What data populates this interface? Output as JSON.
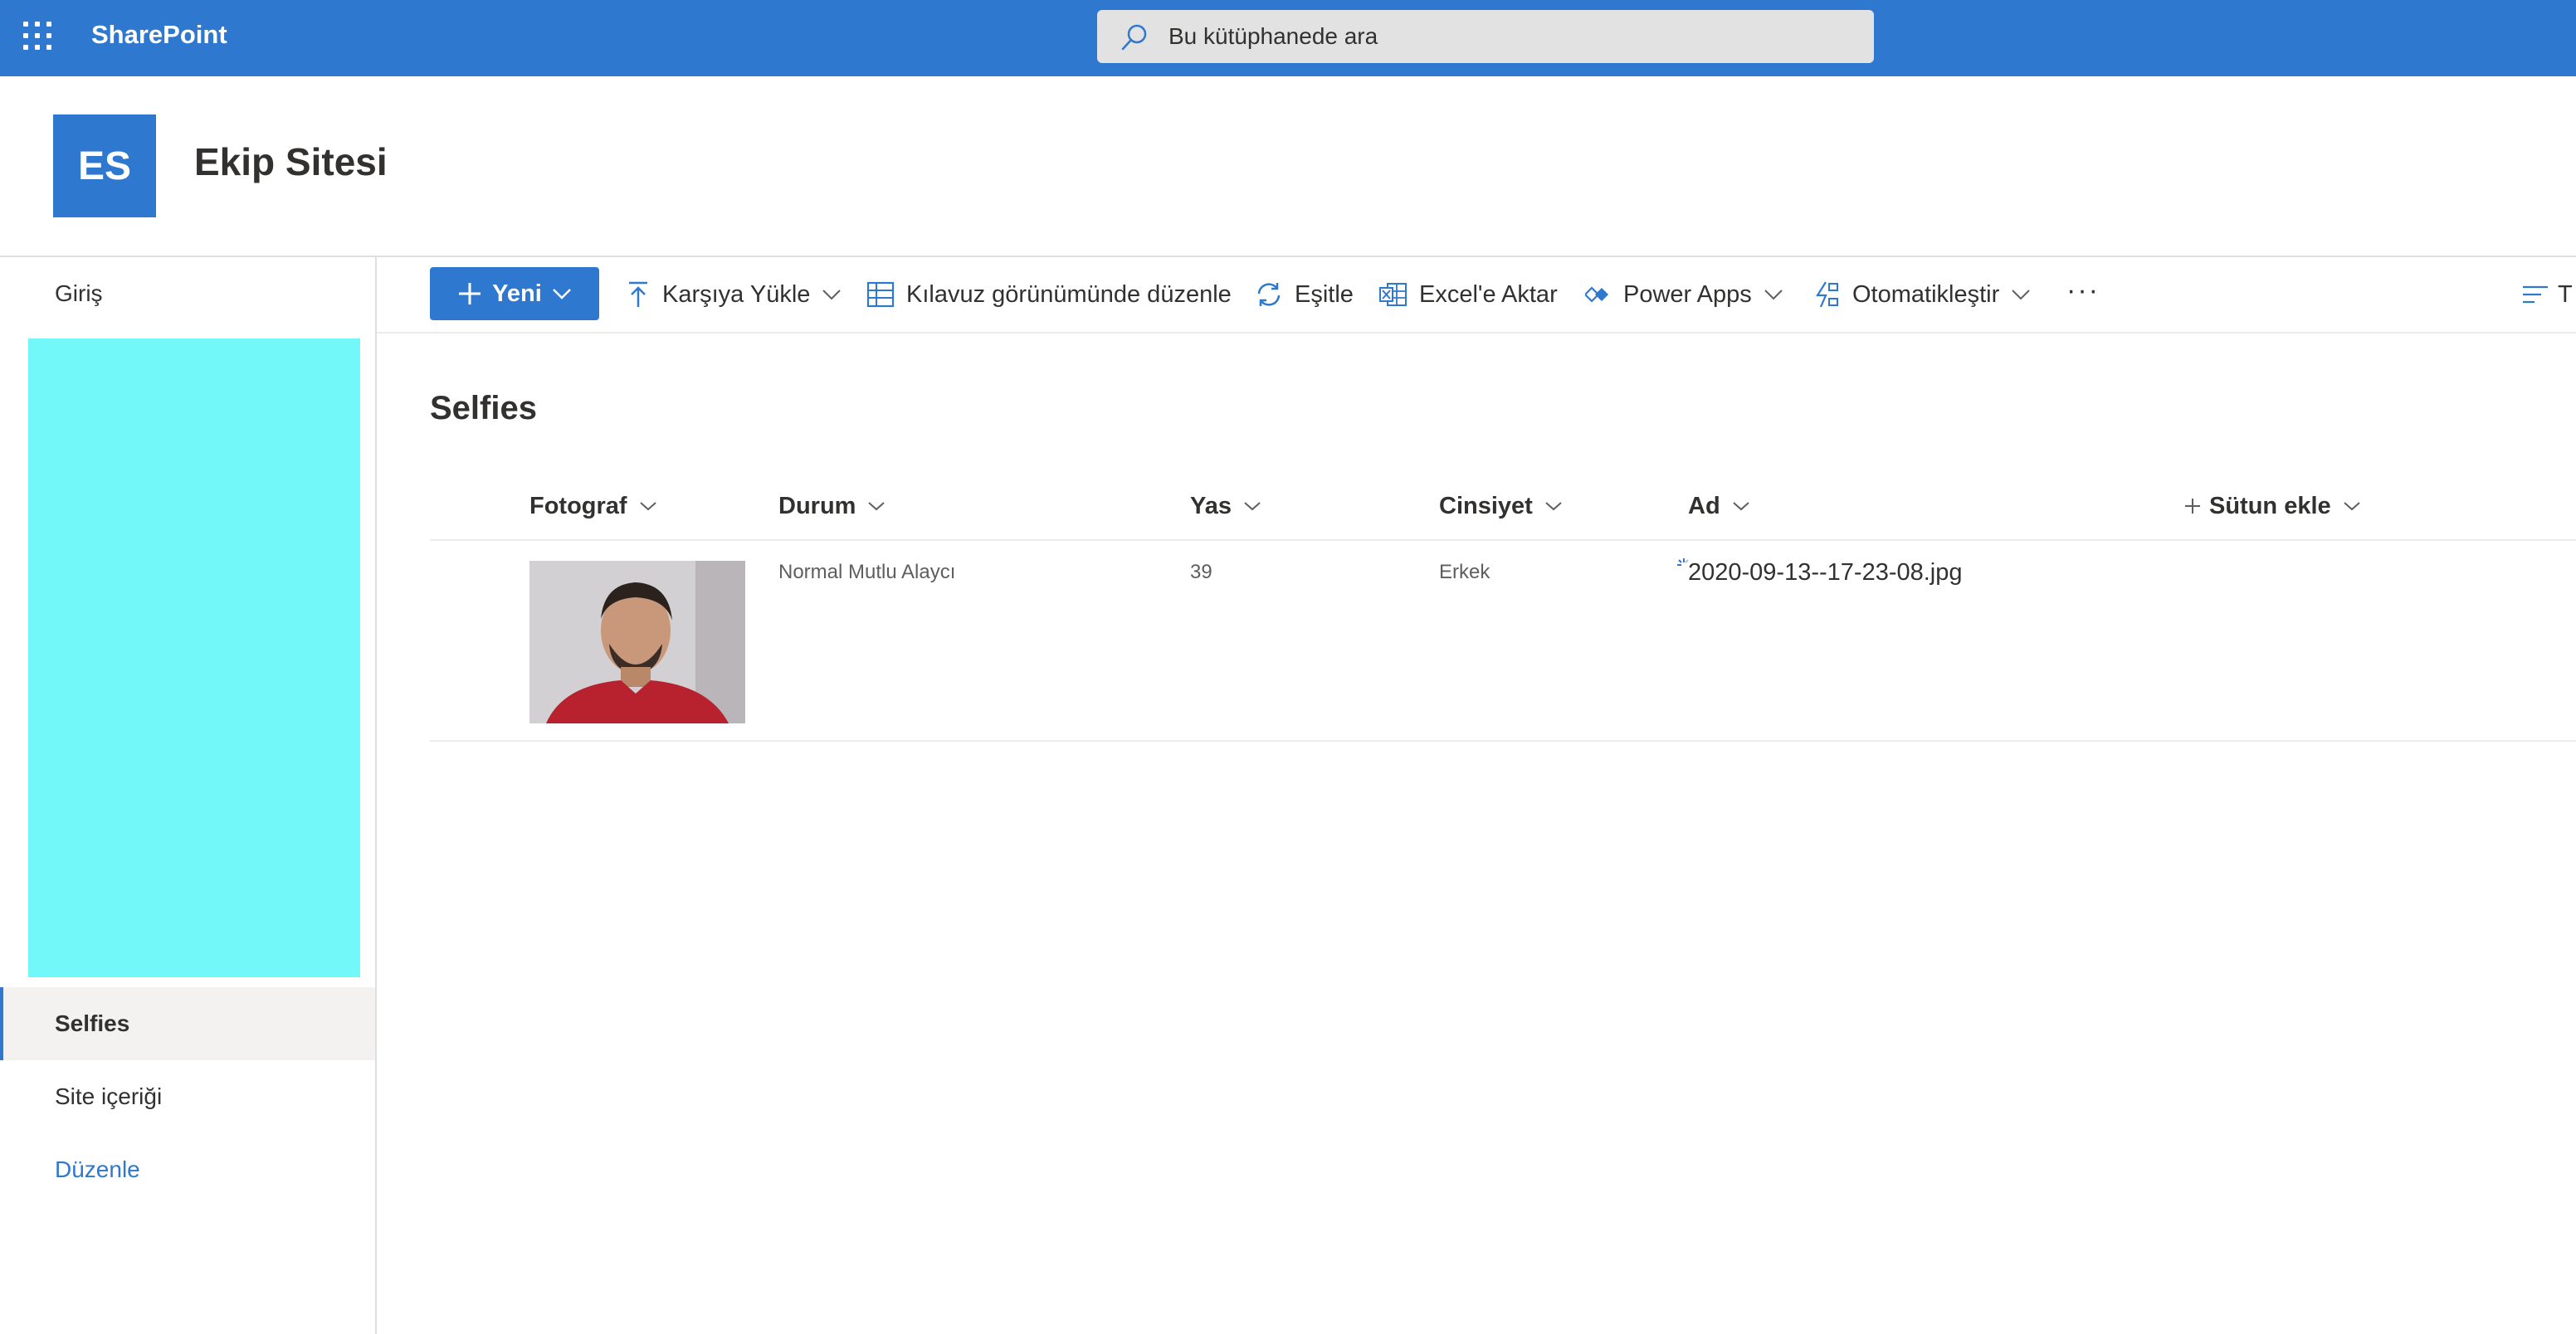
{
  "suitebar": {
    "app_name": "SharePoint",
    "search_placeholder": "Bu kütüphanede ara",
    "icons": [
      "waffle-icon",
      "search-icon"
    ]
  },
  "site": {
    "logo_initials": "ES",
    "title": "Ekip Sitesi"
  },
  "leftnav": {
    "items": [
      {
        "label": "Giriş",
        "active": false
      },
      {
        "label": "Selfies",
        "active": true
      },
      {
        "label": "Site içeriği",
        "active": false
      },
      {
        "label": "Düzenle",
        "active": false
      }
    ]
  },
  "commandbar": {
    "new_label": "Yeni",
    "upload_label": "Karşıya Yükle",
    "grid_edit_label": "Kılavuz görünümünde düzenle",
    "sync_label": "Eşitle",
    "excel_label": "Excel'e Aktar",
    "powerapps_label": "Power Apps",
    "automate_label": "Otomatikleştir",
    "more_label": "···",
    "view_options_label": "T"
  },
  "list": {
    "title": "Selfies",
    "columns": [
      "Fotograf",
      "Durum",
      "Yas",
      "Cinsiyet",
      "Ad"
    ],
    "add_column_label": "Sütun ekle",
    "rows": [
      {
        "durum": "Normal Mutlu Alaycı",
        "yas": "39",
        "cinsiyet": "Erkek",
        "ad": "2020-09-13--17-23-08.jpg"
      }
    ]
  },
  "colors": {
    "accent": "#2f78cf",
    "highlight_box": "#72f8f8"
  }
}
